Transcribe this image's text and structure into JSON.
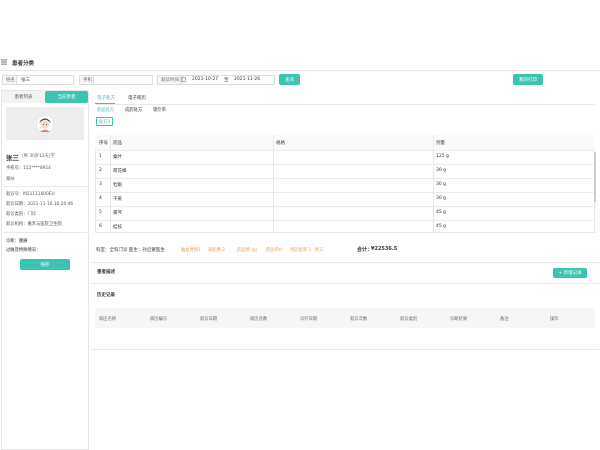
{
  "header": {
    "title": "患者分类"
  },
  "search": {
    "name_label": "姓名",
    "name_value": "张三",
    "phone_label": "手机",
    "phone_value": "",
    "time_label": "就诊时间",
    "date_from": "2021-10-27",
    "date_to": "2021-11-26",
    "range_sep": "至",
    "query_button": "查询",
    "print_button": "我的打印"
  },
  "left": {
    "tab_list": "患者列表",
    "tab_current": "当前患者",
    "patient_name": "张三",
    "patient_meta": "(男 30岁12天)学",
    "phone": "手机号：152****8914",
    "address": "郑州",
    "visit_no": "就诊号：M21111600EU",
    "visit_date": "就诊日期：2021-11-16 16:20:46",
    "dept": "就诊类别：门诊",
    "org": "就诊机构：嘉禾与医院卫生院",
    "diagnosis": "诊断：腰痛",
    "past_history": "过敏及特殊情况：",
    "save_button": "保存"
  },
  "main": {
    "tabs": [
      "电子处方",
      "电子病历"
    ],
    "subtabs": [
      "药品处方",
      "成药处方",
      "理疗单"
    ],
    "recipe_tag": "处方1",
    "table": {
      "headers": [
        "序号",
        "药品",
        "规格",
        "剂量"
      ],
      "rows": [
        [
          "1",
          "桑叶",
          "",
          "125 g"
        ],
        [
          "2",
          "荷花蜂",
          "",
          "30 g"
        ],
        [
          "3",
          "牡蛎",
          "",
          "30 g"
        ],
        [
          "4",
          "干姜",
          "",
          "30 g"
        ],
        [
          "5",
          "黄芩",
          "",
          "45 g"
        ],
        [
          "6",
          "桂枝",
          "",
          "45 g"
        ]
      ]
    },
    "cost_label": "科室：全科门诊 医生：孙启蒙医生",
    "cost_items": [
      "抽血费用1",
      "调配费 2",
      "药品费 (g)",
      "药品单价",
      "用药配率 1",
      "附方"
    ],
    "total_label": "合计：",
    "total_value": "¥22536.5",
    "section_title": "患者描述",
    "new_button": "+ 新增记录",
    "history_title": "历史记录",
    "history_cols": [
      "病区名称",
      "病历编号",
      "就诊日期",
      "病历总数",
      "诊疗日期",
      "就诊次数",
      "就诊类别",
      "诊断结果",
      "备注",
      "操作"
    ]
  }
}
